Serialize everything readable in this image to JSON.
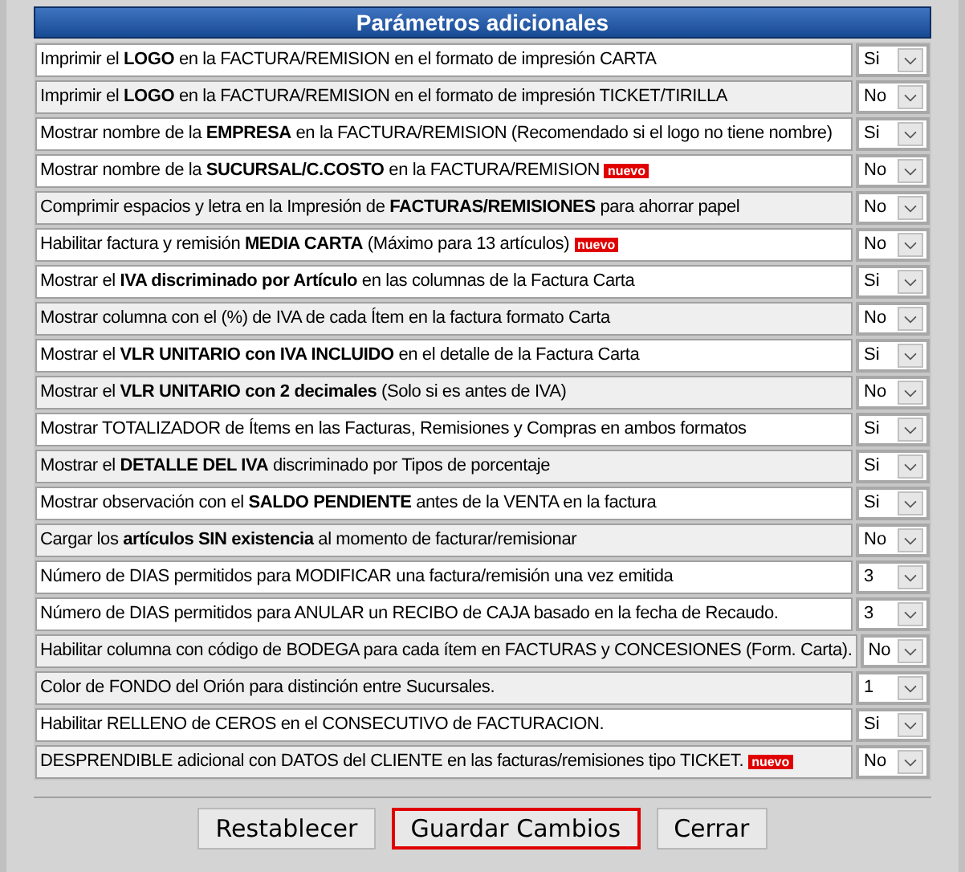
{
  "title": "Parámetros adicionales",
  "rows": [
    {
      "label": "Imprimir el **LOGO** en la FACTURA/REMISION en el formato de impresión CARTA",
      "value": "Si",
      "shaded": false
    },
    {
      "label": "Imprimir el **LOGO** en la FACTURA/REMISION en el formato de impresión TICKET/TIRILLA",
      "value": "No",
      "shaded": true
    },
    {
      "label": "Mostrar nombre de la **EMPRESA** en la FACTURA/REMISION (Recomendado si el logo no tiene nombre)",
      "value": "Si",
      "shaded": false
    },
    {
      "label": "Mostrar nombre de la **SUCURSAL/C.COSTO** en la FACTURA/REMISION",
      "badge": "nuevo",
      "value": "No",
      "shaded": false
    },
    {
      "label": "Comprimir espacios y letra en la Impresión de **FACTURAS/REMISIONES** para ahorrar papel",
      "value": "No",
      "shaded": true
    },
    {
      "label": "Habilitar factura y remisión **MEDIA CARTA** (Máximo para 13 artículos)",
      "badge": "nuevo",
      "value": "No",
      "shaded": false
    },
    {
      "label": "Mostrar el **IVA discriminado por Artículo** en las columnas de la Factura Carta",
      "value": "Si",
      "shaded": false
    },
    {
      "label": "Mostrar columna con el (%) de IVA de cada Ítem en la factura formato Carta",
      "value": "No",
      "shaded": true
    },
    {
      "label": "Mostrar el **VLR UNITARIO con IVA INCLUIDO** en el detalle de la Factura Carta",
      "value": "Si",
      "shaded": false
    },
    {
      "label": "Mostrar el **VLR UNITARIO con 2 decimales** (Solo si es antes de IVA)",
      "value": "No",
      "shaded": true
    },
    {
      "label": "Mostrar TOTALIZADOR de Ítems en las Facturas, Remisiones y Compras en ambos formatos",
      "value": "Si",
      "shaded": false
    },
    {
      "label": "Mostrar el **DETALLE DEL IVA** discriminado por Tipos de porcentaje",
      "value": "Si",
      "shaded": true
    },
    {
      "label": "Mostrar observación con el **SALDO PENDIENTE** antes de la VENTA en la factura",
      "value": "Si",
      "shaded": false
    },
    {
      "label": "Cargar los **artículos SIN existencia** al momento de facturar/remisionar",
      "value": "No",
      "shaded": true
    },
    {
      "label": "Número de DIAS permitidos para MODIFICAR una factura/remisión una vez emitida",
      "value": "3",
      "shaded": false
    },
    {
      "label": "Número de DIAS permitidos para ANULAR un RECIBO de CAJA basado en la fecha de Recaudo.",
      "value": "3",
      "shaded": false
    },
    {
      "label": "Habilitar columna con código de BODEGA para cada ítem en FACTURAS y CONCESIONES (Form. Carta).",
      "value": "No",
      "shaded": true
    },
    {
      "label": "Color de FONDO del Orión para distinción entre Sucursales.",
      "value": "1",
      "shaded": true
    },
    {
      "label": "Habilitar RELLENO de CEROS en el CONSECUTIVO de FACTURACION.",
      "value": "Si",
      "shaded": false
    },
    {
      "label": "DESPRENDIBLE adicional con DATOS del CLIENTE en las facturas/remisiones tipo TICKET.",
      "badge": "nuevo",
      "value": "No",
      "shaded": true
    }
  ],
  "buttons": [
    {
      "label": "Restablecer",
      "focused": false
    },
    {
      "label": "Guardar Cambios",
      "focused": true
    },
    {
      "label": "Cerrar",
      "focused": false
    }
  ]
}
